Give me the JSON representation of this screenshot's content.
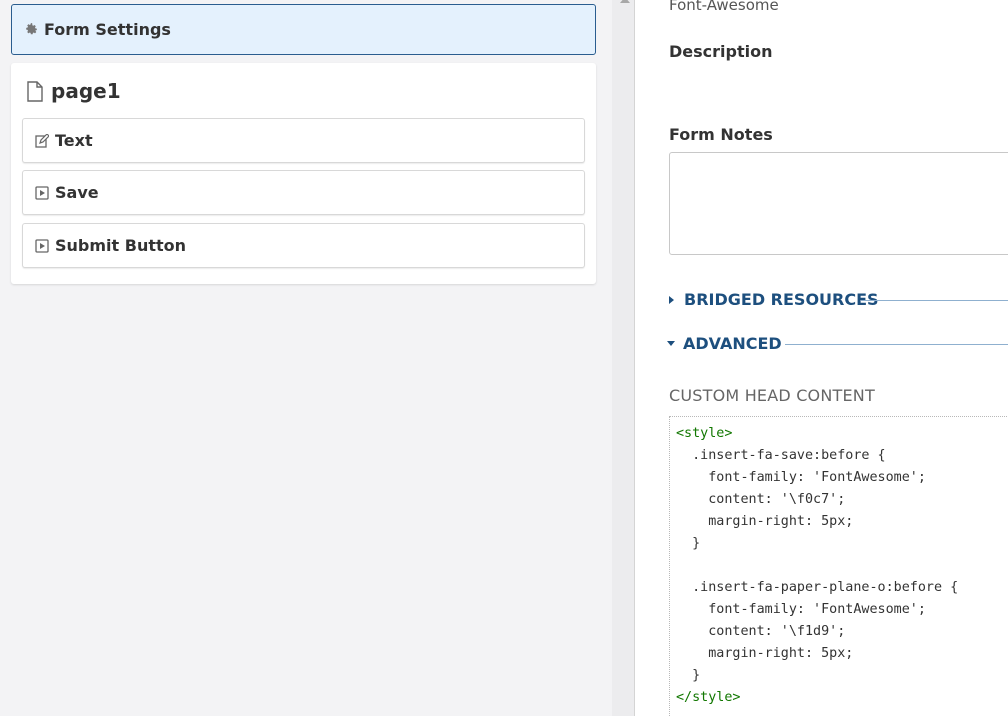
{
  "left_panel": {
    "form_settings_label": "Form Settings",
    "page": {
      "title": "page1",
      "items": [
        {
          "label": "Text",
          "icon": "edit-icon"
        },
        {
          "label": "Save",
          "icon": "play-square-icon"
        },
        {
          "label": "Submit Button",
          "icon": "play-square-icon"
        }
      ]
    }
  },
  "right_panel": {
    "icon_library_value": "Font-Awesome",
    "description_label": "Description",
    "form_notes_label": "Form Notes",
    "form_notes_value": "",
    "sections": {
      "bridged_resources": "BRIDGED RESOURCES",
      "advanced": "ADVANCED"
    },
    "custom_head_content_label": "CUSTOM HEAD CONTENT",
    "code_lines": [
      "<style>",
      "  .insert-fa-save:before {",
      "    font-family: 'FontAwesome';",
      "    content: '\\f0c7';",
      "    margin-right: 5px;",
      "  }",
      "",
      "  .insert-fa-paper-plane-o:before {",
      "    font-family: 'FontAwesome';",
      "    content: '\\f1d9';",
      "    margin-right: 5px;",
      "  }",
      "</style>"
    ]
  },
  "colors": {
    "accent": "#1d4f7e",
    "selected_bg": "#e4f1fd",
    "selected_border": "#2a5d8f",
    "code_tag": "#117700",
    "code_string": "#aa1111"
  }
}
